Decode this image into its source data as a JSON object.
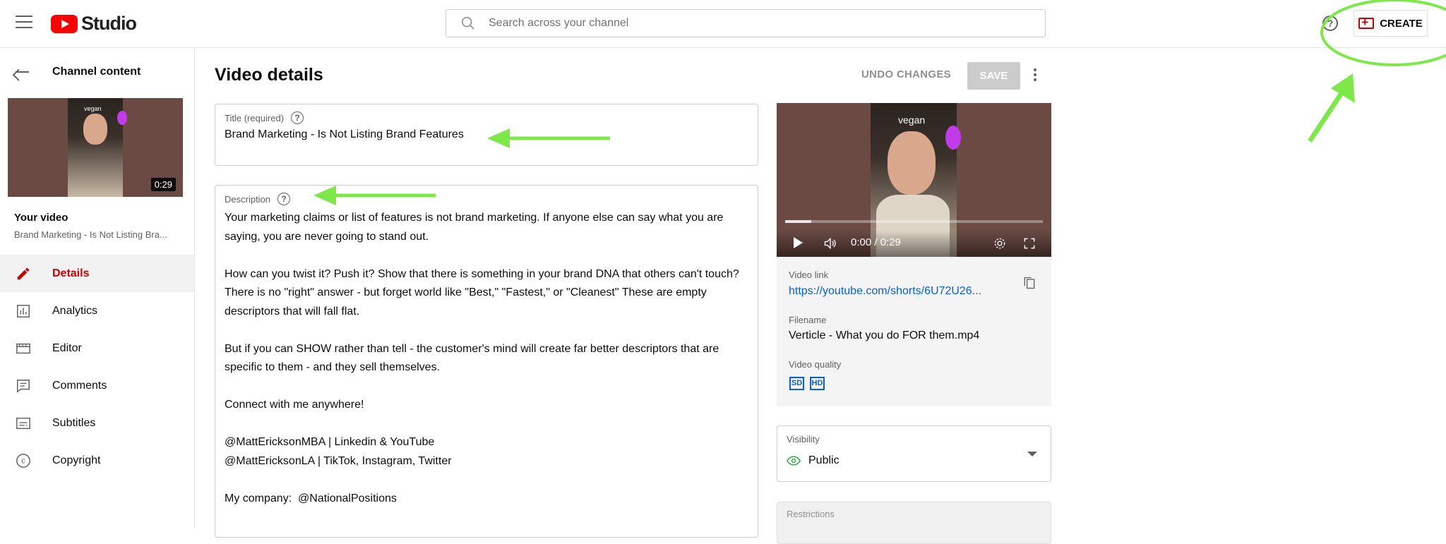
{
  "header": {
    "brand": "Studio",
    "search_placeholder": "Search across your channel",
    "create_label": "CREATE"
  },
  "sidebar": {
    "back_label": "Channel content",
    "thumb_duration": "0:29",
    "thumb_overlay": "vegan",
    "your_video_label": "Your video",
    "your_video_title": "Brand Marketing - Is Not Listing Bra...",
    "items": [
      {
        "label": "Details",
        "icon": "pencil-icon",
        "active": true
      },
      {
        "label": "Analytics",
        "icon": "analytics-icon"
      },
      {
        "label": "Editor",
        "icon": "editor-icon"
      },
      {
        "label": "Comments",
        "icon": "comments-icon"
      },
      {
        "label": "Subtitles",
        "icon": "subtitles-icon"
      },
      {
        "label": "Copyright",
        "icon": "copyright-icon"
      }
    ]
  },
  "main": {
    "page_title": "Video details",
    "undo_label": "UNDO CHANGES",
    "save_label": "SAVE",
    "title_label": "Title (required)",
    "title_value": "Brand Marketing - Is Not Listing Brand Features",
    "description_label": "Description",
    "description_value": "Your marketing claims or list of features is not brand marketing. If anyone else can say what you are saying, you are never going to stand out.\n\nHow can you twist it? Push it? Show that there is something in your brand DNA that others can't touch? There is no \"right\" answer - but forget world like \"Best,\" \"Fastest,\" or \"Cleanest\" These are empty descriptors that will fall flat.\n\nBut if you can SHOW rather than tell - the customer's mind will create far better descriptors that are specific to them - and they sell themselves.\n\nConnect with me anywhere!\n\n@MattEricksonMBA | Linkedin & YouTube\n@MattEricksonLA | TikTok, Instagram, Twitter\n\nMy company:  @NationalPositions"
  },
  "player": {
    "overlay_text": "vegan",
    "time": "0:00 / 0:29",
    "progress": 0.1
  },
  "info": {
    "video_link_label": "Video link",
    "video_link": "https://youtube.com/shorts/6U72U26...",
    "filename_label": "Filename",
    "filename": "Verticle - What you do FOR them.mp4",
    "quality_label": "Video quality",
    "quality_badges": [
      "SD",
      "HD"
    ]
  },
  "visibility": {
    "label": "Visibility",
    "value": "Public"
  },
  "restrictions": {
    "label": "Restrictions"
  },
  "colors": {
    "accent": "#cc0000",
    "link": "#065fd4",
    "annotation": "#7ee84a"
  }
}
